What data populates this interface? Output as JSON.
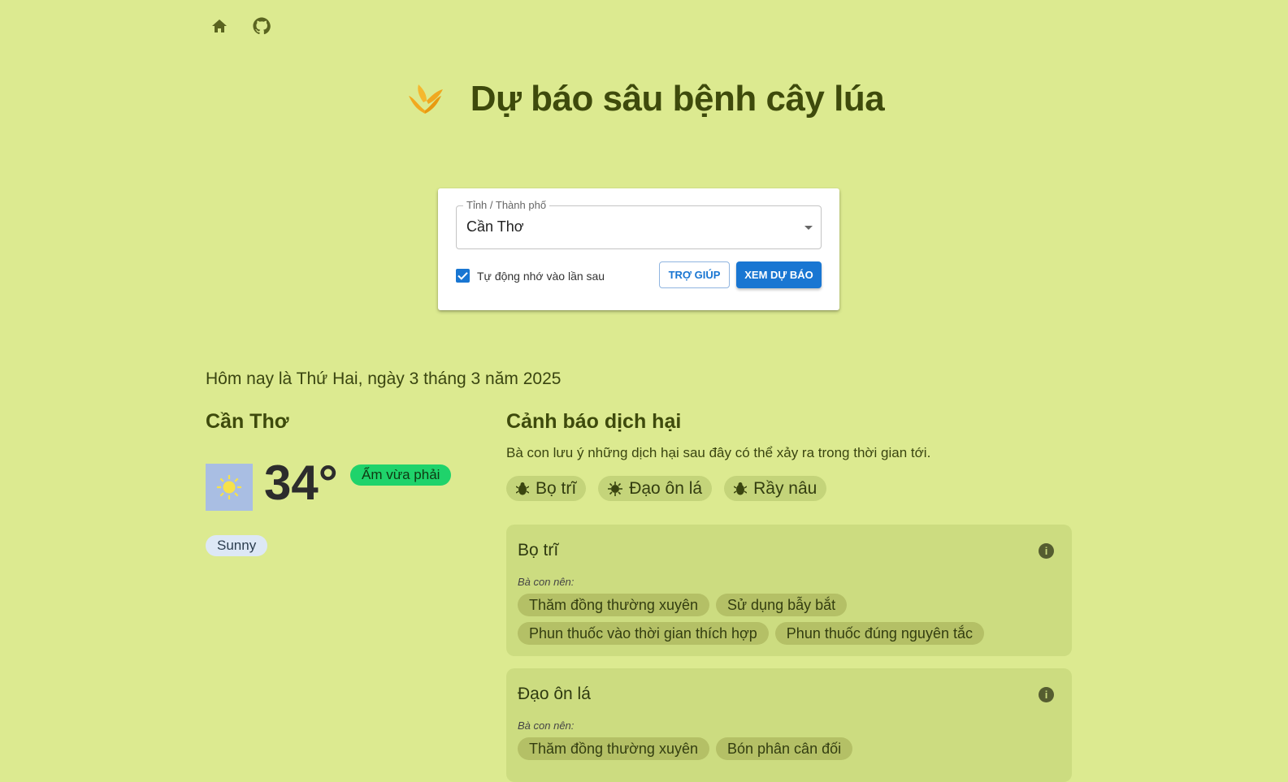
{
  "nav": {
    "home_icon": "home-icon",
    "github_icon": "github-icon"
  },
  "header": {
    "title": "Dự báo sâu bệnh cây lúa",
    "logo_icon": "rice-leaf-logo"
  },
  "form": {
    "province_label": "Tỉnh / Thành phố",
    "province_value": "Cần Thơ",
    "remember_label": "Tự động nhớ vào lần sau",
    "remember_checked": true,
    "help_button": "TRỢ GIÚP",
    "forecast_button": "XEM DỰ BÁO"
  },
  "today": "Hôm nay là Thứ Hai, ngày 3 tháng 3 năm 2025",
  "weather": {
    "city": "Cần Thơ",
    "temperature": "34°",
    "humidity_badge": "Ẩm vừa phải",
    "condition": "Sunny",
    "icon": "sun-icon"
  },
  "alerts": {
    "title": "Cảnh báo dịch hại",
    "description": "Bà con lưu ý những dịch hại sau đây có thể xảy ra trong thời gian tới.",
    "pests": [
      "Bọ trĩ",
      "Đạo ôn lá",
      "Rầy nâu"
    ],
    "cards": [
      {
        "name": "Bọ trĩ",
        "advice_label": "Bà con nên:",
        "advice_rows": [
          [
            "Thăm đồng thường xuyên",
            "Sử dụng bẫy bắt"
          ],
          [
            "Phun thuốc vào thời gian thích hợp",
            "Phun thuốc đúng nguyên tắc"
          ]
        ]
      },
      {
        "name": "Đạo ôn lá",
        "advice_label": "Bà con nên:",
        "advice_rows": [
          [
            "Thăm đồng thường xuyên",
            "Bón phân cân đối"
          ]
        ]
      }
    ]
  },
  "colors": {
    "background": "#dcea90",
    "primary": "#1976d2",
    "humidity": "#1fd36b",
    "card": "#ccdc80"
  }
}
